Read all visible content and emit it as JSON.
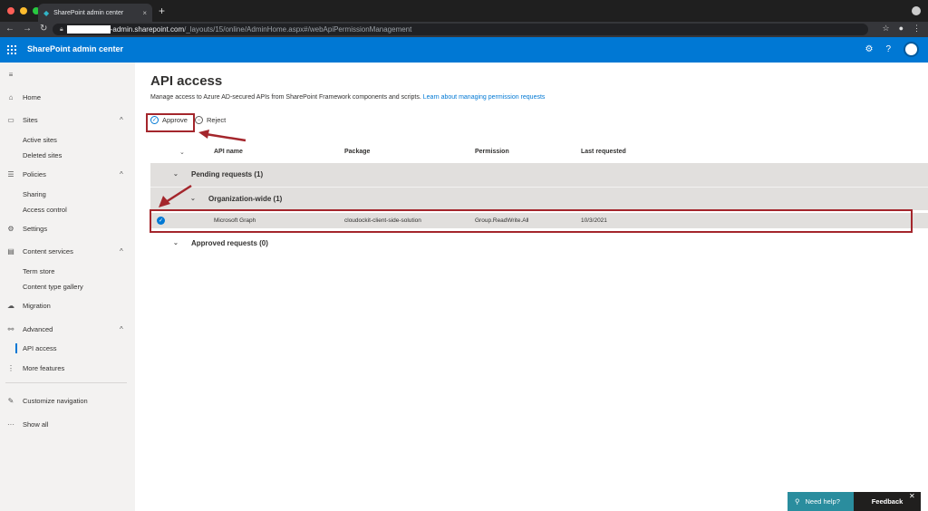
{
  "browser": {
    "tab_title": "SharePoint admin center",
    "tab_close": "×",
    "new_tab": "+",
    "url_host": "-admin.sharepoint.com",
    "url_path": "/_layouts/15/online/AdminHome.aspx#/webApiPermissionManagement",
    "colors": {
      "red": "#ff5f57",
      "yellow": "#febc2e",
      "green": "#28c840"
    }
  },
  "app": {
    "title": "SharePoint admin center",
    "accent": "#0078d4"
  },
  "sidebar": {
    "items": [
      {
        "label": "Home",
        "icon": "home-icon",
        "glyph": "⌂"
      },
      {
        "label": "Sites",
        "icon": "sites-icon",
        "glyph": "▭",
        "chev": "^"
      },
      {
        "label": "Active sites"
      },
      {
        "label": "Deleted sites"
      },
      {
        "label": "Policies",
        "icon": "policies-icon",
        "glyph": "☰",
        "chev": "^"
      },
      {
        "label": "Sharing"
      },
      {
        "label": "Access control"
      },
      {
        "label": "Settings",
        "icon": "settings-icon",
        "glyph": "⚙"
      },
      {
        "label": "Content services",
        "icon": "content-services-icon",
        "glyph": "▤",
        "chev": "^"
      },
      {
        "label": "Term store"
      },
      {
        "label": "Content type gallery"
      },
      {
        "label": "Migration",
        "icon": "migration-icon",
        "glyph": "☁"
      },
      {
        "label": "Advanced",
        "icon": "advanced-icon",
        "glyph": "⚯",
        "chev": "^"
      },
      {
        "label": "API access"
      },
      {
        "label": "More features",
        "icon": "more-features-icon",
        "glyph": "⋮"
      },
      {
        "label": "Customize navigation",
        "icon": "pencil-icon",
        "glyph": "✎"
      },
      {
        "label": "Show all",
        "icon": "ellipsis-icon",
        "glyph": "···"
      }
    ]
  },
  "main": {
    "title": "API access",
    "description": "Manage access to Azure AD-secured APIs from SharePoint Framework components and scripts.",
    "learn_link": "Learn about managing permission requests",
    "commands": {
      "approve": "Approve",
      "reject": "Reject"
    },
    "columns": [
      "API name",
      "Package",
      "Permission",
      "Last requested"
    ],
    "groups": {
      "pending": "Pending requests (1)",
      "org_wide": "Organization-wide (1)",
      "approved": "Approved requests (0)"
    },
    "rows": [
      {
        "api": "Microsoft Graph",
        "package": "cloudockit-client-side-solution",
        "permission": "Group.ReadWrite.All",
        "last_requested": "10/3/2021"
      }
    ]
  },
  "footer": {
    "help": "Need help?",
    "feedback": "Feedback"
  }
}
